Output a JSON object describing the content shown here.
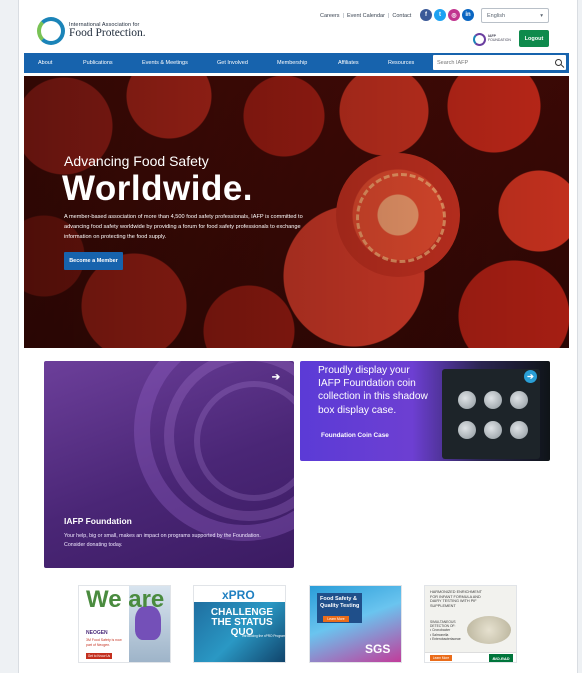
{
  "header": {
    "logo_line1": "International Association for",
    "logo_line2": "Food Protection.",
    "top_links": [
      "Careers",
      "Event Calendar",
      "Contact"
    ],
    "social_icons": [
      {
        "name": "facebook-icon",
        "glyph": "f",
        "color": "#3b5998"
      },
      {
        "name": "twitter-icon",
        "glyph": "t",
        "color": "#1da1f2"
      },
      {
        "name": "instagram-icon",
        "glyph": "◎",
        "color": "#c1358f"
      },
      {
        "name": "linkedin-icon",
        "glyph": "in",
        "color": "#0a66c2"
      }
    ],
    "language_selected": "English",
    "foundation_logo_line1": "IAFP",
    "foundation_logo_line2": "FOUNDATION",
    "logout_label": "Logout"
  },
  "nav": {
    "items": [
      "About",
      "Publications",
      "Events & Meetings",
      "Get Involved",
      "Membership",
      "Affiliates",
      "Resources"
    ],
    "search_placeholder": "Search IAFP"
  },
  "hero": {
    "subtitle": "Advancing Food Safety",
    "title": "Worldwide.",
    "body": "A member-based association of more than 4,500 food safety professionals, IAFP is committed to advancing food safety worldwide by providing a forum for food safety professionals to exchange information on protecting the food supply.",
    "cta": "Become a Member"
  },
  "promos": {
    "foundation": {
      "title": "IAFP Foundation",
      "description": "Your help, big or small, makes an impact on programs supported by the Foundation. Consider donating today."
    },
    "coin": {
      "headline": "Proudly display your IAFP Foundation coin collection in this shadow box display case.",
      "caption": "Foundation Coin Case"
    }
  },
  "sponsors": {
    "neogen": {
      "we_are": "We are",
      "brand": "NEOGEN",
      "small": "3M Food Safety is now part of Neogen.",
      "button": "Get to Know Us"
    },
    "xpro": {
      "brand": "xPRO",
      "headline": "CHALLENGE THE STATUS QUO",
      "intro": "Introducing the xPRO Program"
    },
    "sgs": {
      "headline": "Food Safety & Quality Testing",
      "button": "Learn More",
      "brand": "SGS"
    },
    "biorad": {
      "headline": "HARMONIZED ENRICHMENT FOR INFANT FORMULA AND DAIRY TESTING WITH PIF SUPPLEMENT",
      "subhead": "SIMULTANEOUS DETECTION OF:",
      "bullets": [
        "• Cronobacter",
        "• Salmonella",
        "• Enterobacteriaceae"
      ],
      "button": "Learn More",
      "brand": "BIO-RAD"
    }
  }
}
